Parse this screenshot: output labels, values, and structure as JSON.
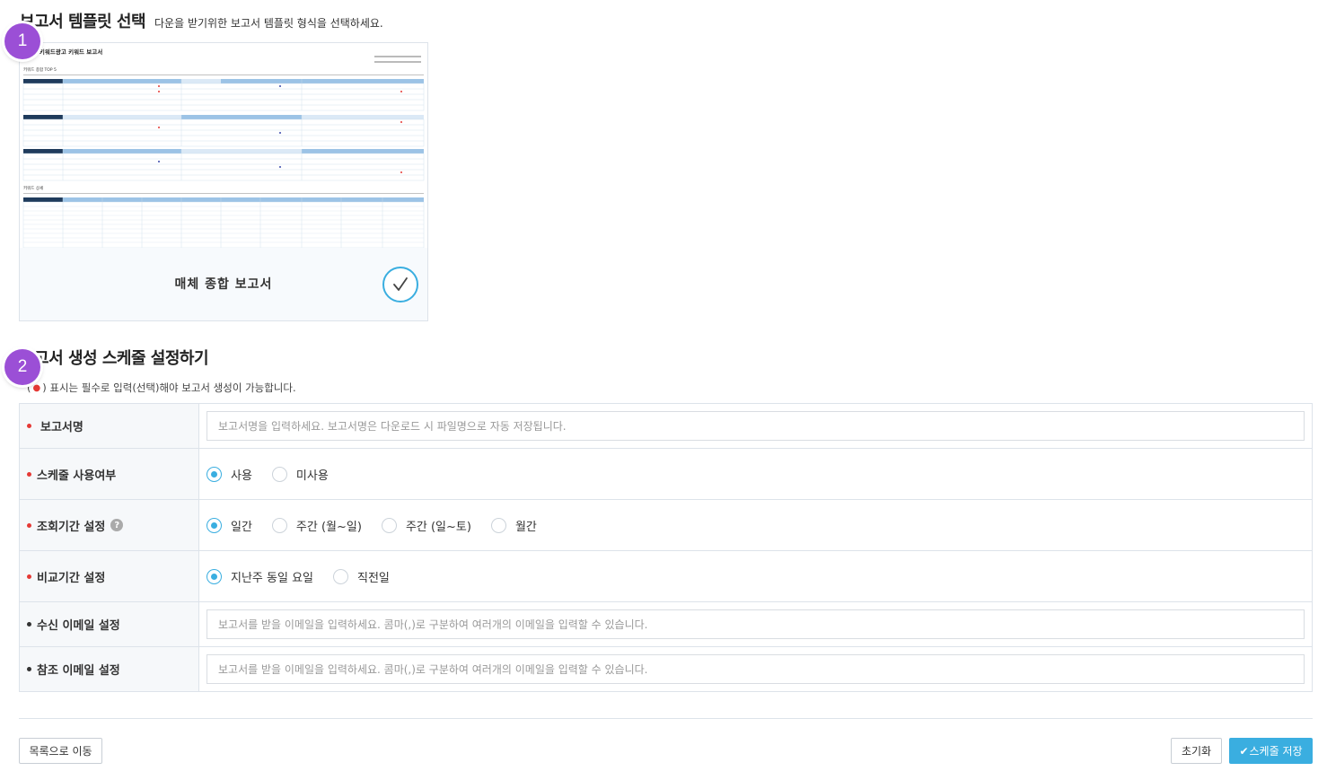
{
  "section1": {
    "title": "보고서 템플릿 선택",
    "subtitle": "다운을 받기위한 보고서 템플릿 형식을 선택하세요."
  },
  "markers": [
    "1",
    "2"
  ],
  "template_card": {
    "label": "매체 종합 보고서",
    "preview": {
      "title": "○ 키워드광고 키워드 보고서",
      "section_a": "키워드 종합 TOP 5",
      "section_b": "키워드 상세"
    }
  },
  "section2": {
    "title": "보고서 생성 스케줄 설정하기",
    "note_open": "(",
    "note_text": ") 표시는 필수로 입력(선택)해야 보고서 생성이 가능합니다."
  },
  "form": {
    "report_name": {
      "label": "보고서명",
      "placeholder": "보고서명을 입력하세요. 보고서명은 다운로드 시 파일명으로 자동 저장됩니다."
    },
    "schedule_use": {
      "label": "스케줄 사용여부",
      "options": [
        "사용",
        "미사용"
      ],
      "selected": "사용"
    },
    "query_period": {
      "label": "조회기간 설정",
      "help_icon": "question-icon",
      "options": [
        "일간",
        "주간 (월~일)",
        "주간 (일~토)",
        "월간"
      ],
      "selected": "일간"
    },
    "compare_period": {
      "label": "비교기간 설정",
      "options": [
        "지난주 동일 요일",
        "직전일"
      ],
      "selected": "지난주 동일 요일"
    },
    "recipient_email": {
      "label": "수신 이메일 설정",
      "placeholder": "보고서를 받을 이메일을 입력하세요. 콤마(,)로 구분하여 여러개의 이메일을 입력할 수 있습니다."
    },
    "cc_email": {
      "label": "참조 이메일 설정",
      "placeholder": "보고서를 받을 이메일을 입력하세요. 콤마(,)로 구분하여 여러개의 이메일을 입력할 수 있습니다."
    }
  },
  "footer": {
    "back_label": "목록으로 이동",
    "reset_label": "초기화",
    "save_label": "스케줄 저장"
  },
  "colors": {
    "accent": "#3aaee0",
    "required": "#e53935",
    "marker": "#9b4fd6"
  }
}
